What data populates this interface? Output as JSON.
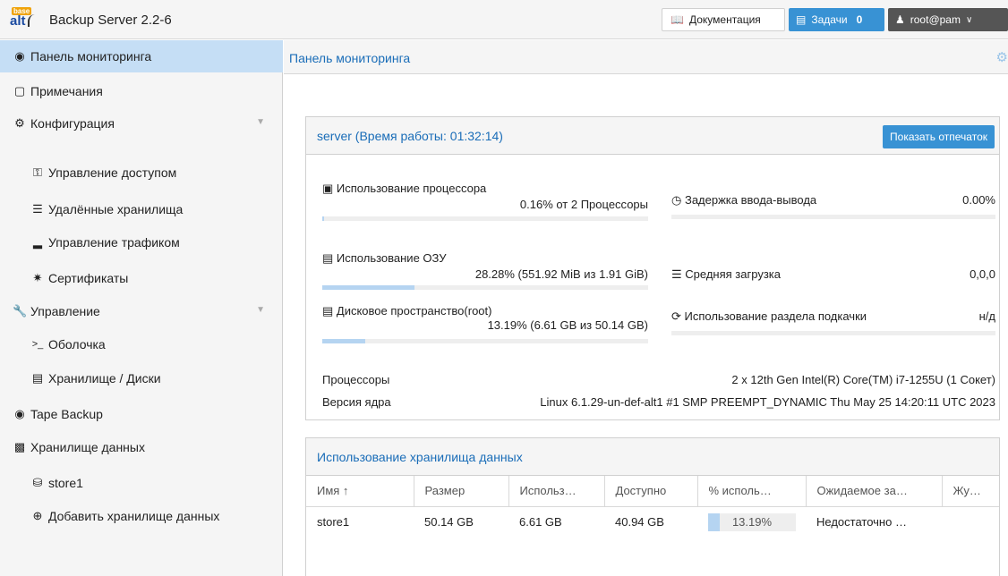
{
  "header": {
    "logo_base": "base",
    "logo_alt": "alt",
    "title": "Backup Server 2.2-6",
    "docs_label": "Документация",
    "tasks_label": "Задачи",
    "tasks_count": "0",
    "user_label": "root@pam",
    "icons": {
      "docs": "book-icon",
      "tasks": "list-icon",
      "user": "user-icon",
      "dropdown": "chevron-down-icon"
    }
  },
  "sidebar": {
    "items": [
      {
        "label": "Панель мониторинга",
        "icon": "dashboard-icon",
        "active": true
      },
      {
        "label": "Примечания",
        "icon": "note-icon"
      },
      {
        "label": "Конфигурация",
        "icon": "gears-icon"
      },
      {
        "label": "Управление доступом",
        "icon": "key-icon"
      },
      {
        "label": "Удалённые хранилища",
        "icon": "server-icon"
      },
      {
        "label": "Управление трафиком",
        "icon": "traffic-icon"
      },
      {
        "label": "Сертификаты",
        "icon": "certificate-icon"
      },
      {
        "label": "Управление",
        "icon": "wrench-icon"
      },
      {
        "label": "Оболочка",
        "icon": "terminal-icon"
      },
      {
        "label": "Хранилище / Диски",
        "icon": "hdd-icon"
      },
      {
        "label": "Tape Backup",
        "icon": "tape-icon"
      },
      {
        "label": "Хранилище данных",
        "icon": "archive-icon"
      },
      {
        "label": "store1",
        "icon": "database-icon"
      },
      {
        "label": "Добавить хранилище данных",
        "icon": "plus-circle-icon"
      }
    ]
  },
  "main": {
    "title": "Панель мониторинга",
    "server_panel": {
      "title": "server (Время работы: 01:32:14)",
      "fingerprint_button": "Показать отпечаток",
      "cpu": {
        "label": "Использование процессора",
        "value": "0.16% от 2 Процессоры",
        "percent": 0.16
      },
      "ram": {
        "label": "Использование ОЗУ",
        "value": "28.28% (551.92 MiB из 1.91 GiB)",
        "percent": 28.28
      },
      "disk": {
        "label": "Дисковое пространство(root)",
        "value": "13.19% (6.61 GB из 50.14 GB)",
        "percent": 13.19
      },
      "io_delay": {
        "label": "Задержка ввода-вывода",
        "value": "0.00%"
      },
      "load": {
        "label": "Средняя загрузка",
        "value": "0,0,0"
      },
      "swap": {
        "label": "Использование раздела подкачки",
        "value": "н/д"
      },
      "cpus": {
        "label": "Процессоры",
        "value": "2 x 12th Gen Intel(R) Core(TM) i7-1255U (1 Сокет)"
      },
      "kernel": {
        "label": "Версия ядра",
        "value": "Linux 6.1.29-un-def-alt1 #1 SMP PREEMPT_DYNAMIC Thu May 25 14:20:11 UTC 2023"
      }
    },
    "datastore_panel": {
      "title": "Использование хранилища данных",
      "columns": [
        "Имя ↑",
        "Размер",
        "Использ…",
        "Доступно",
        "% исполь…",
        "Ожидаемое за…",
        "Жу…"
      ],
      "rows": [
        {
          "name": "store1",
          "size": "50.14 GB",
          "used": "6.61 GB",
          "avail": "40.94 GB",
          "pct": "13.19%",
          "pct_value": 13.19,
          "estimated": "Недостаточно …",
          "journal": ""
        }
      ]
    }
  }
}
